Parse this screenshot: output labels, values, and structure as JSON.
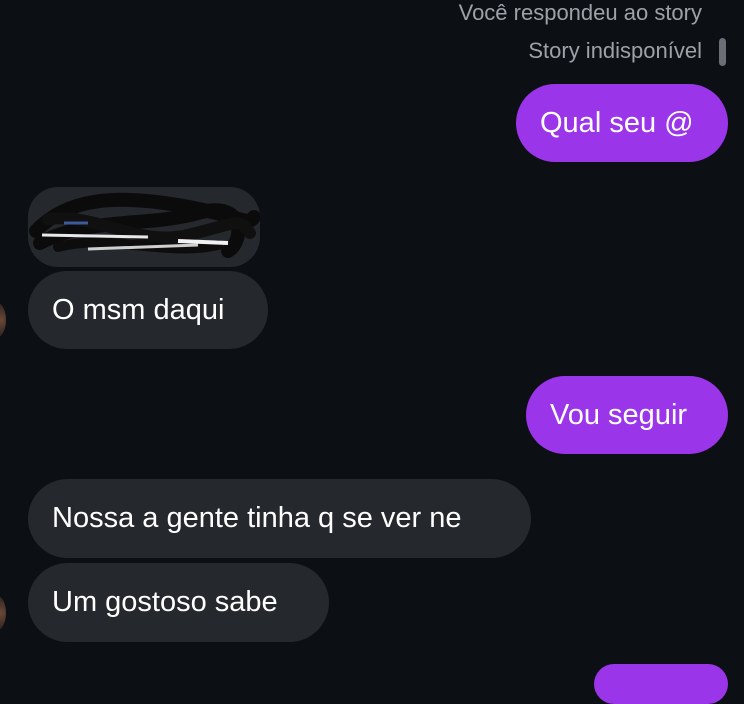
{
  "story_reply": {
    "status": "Você respondeu ao story",
    "unavailable": "Story indisponível"
  },
  "messages": [
    {
      "direction": "sent",
      "text": "Qual seu @"
    },
    {
      "direction": "received",
      "text": "",
      "redacted": true
    },
    {
      "direction": "received",
      "text": "O msm daqui"
    },
    {
      "direction": "sent",
      "text": "Vou seguir"
    },
    {
      "direction": "received",
      "text": "Nossa a gente tinha q se ver ne"
    },
    {
      "direction": "received",
      "text": "Um gostoso sabe"
    },
    {
      "direction": "sent",
      "text": ""
    }
  ],
  "colors": {
    "background": "#0c0f14",
    "sent_bubble": "#9b35e9",
    "received_bubble": "#25282d",
    "meta_text": "#9ea2a8"
  }
}
